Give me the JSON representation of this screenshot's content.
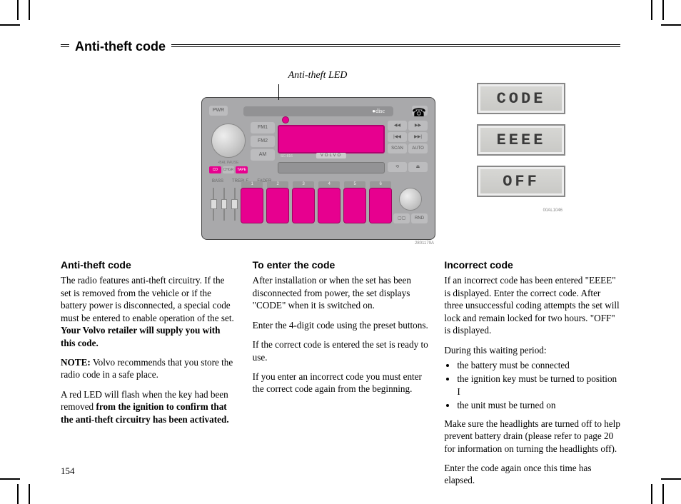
{
  "page_title": "Anti-theft code",
  "page_number": "154",
  "figure": {
    "led_label": "Anti-theft LED",
    "pwr": "PWR",
    "fm1": "FM1",
    "fm2": "FM2",
    "am": "AM",
    "cd": "CD",
    "chgr": "CHGR",
    "tape": "TAPE",
    "bass": "BASS",
    "treble": "TREBLE",
    "fader": "FADER",
    "bal_pause": "BAL\nPAUSE",
    "model": "SC-816",
    "volvo": "VOLVO",
    "scan": "SCAN",
    "auto": "AUTO",
    "rnd": "RND",
    "presets": [
      "1",
      "2",
      "3",
      "4",
      "5",
      "6"
    ],
    "caption_main": "2801179A",
    "lcd1": "CODE",
    "lcd2": "EEEE",
    "lcd3": "OFF",
    "caption_lcd": "00AL1046"
  },
  "columns": {
    "col1": {
      "heading": "Anti-theft code",
      "p1": "The radio features anti-theft circuitry. If the set is removed from the vehicle or if the battery power is disconnected, a special code must be entered to enable operation of the set.",
      "p1_bold": "Your Volvo retailer will supply you with this code.",
      "note_label": "NOTE:",
      "note_text": " Volvo recommends that you store the radio code in a safe place.",
      "p3_part1": "A red LED will flash when the key had been removed ",
      "p3_bold": "from the ignition to confirm that the anti-theft circuitry has been activated."
    },
    "col2": {
      "heading": "To enter the code",
      "p1": "After installation or when the set has been disconnected from power, the set displays \"CODE\" when it is switched on.",
      "p2": "Enter the 4-digit code using the preset buttons.",
      "p3": "If the correct code is entered the set is ready to use.",
      "p4": "If you enter an incorrect code you must enter the correct code again from the beginning."
    },
    "col3": {
      "heading": "Incorrect code",
      "p1": "If an incorrect code has been entered \"EEEE\" is displayed. Enter the correct code.  After three unsuccessful coding attempts the set will lock and remain locked for two hours. \"OFF\" is displayed.",
      "p2": "During this waiting period:",
      "bullets": [
        "the battery must be connected",
        "the ignition key must be turned to position I",
        "the unit must be turned on"
      ],
      "p3": "Make sure the headlights are turned off to help prevent battery drain (please refer to page 20 for information on turning the headlights off).",
      "p4": "Enter the code again once this time has elapsed."
    }
  }
}
